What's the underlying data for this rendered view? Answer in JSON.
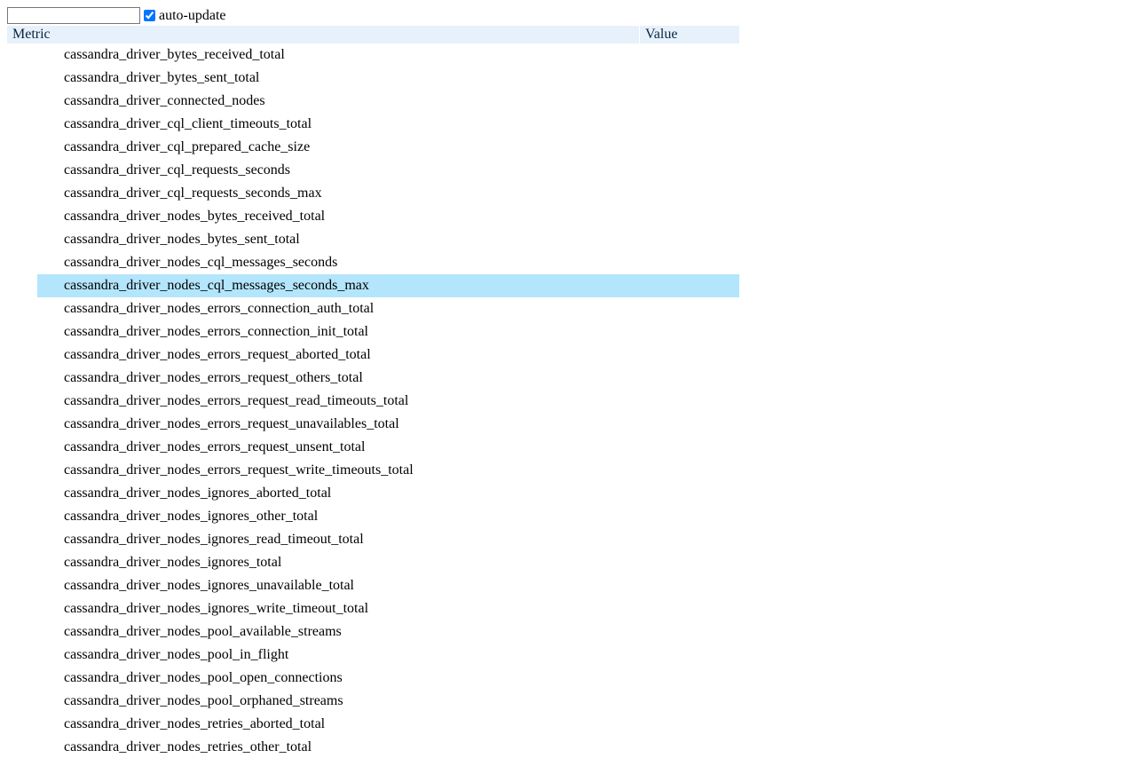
{
  "controls": {
    "filter_value": "",
    "filter_placeholder": "",
    "auto_update_label": "auto-update",
    "auto_update_checked": true
  },
  "table": {
    "header_metric": "Metric",
    "header_value": "Value",
    "rows": [
      {
        "name": "cassandra_driver_bytes_received_total",
        "value": "",
        "selected": false
      },
      {
        "name": "cassandra_driver_bytes_sent_total",
        "value": "",
        "selected": false
      },
      {
        "name": "cassandra_driver_connected_nodes",
        "value": "",
        "selected": false
      },
      {
        "name": "cassandra_driver_cql_client_timeouts_total",
        "value": "",
        "selected": false
      },
      {
        "name": "cassandra_driver_cql_prepared_cache_size",
        "value": "",
        "selected": false
      },
      {
        "name": "cassandra_driver_cql_requests_seconds",
        "value": "",
        "selected": false
      },
      {
        "name": "cassandra_driver_cql_requests_seconds_max",
        "value": "",
        "selected": false
      },
      {
        "name": "cassandra_driver_nodes_bytes_received_total",
        "value": "",
        "selected": false
      },
      {
        "name": "cassandra_driver_nodes_bytes_sent_total",
        "value": "",
        "selected": false
      },
      {
        "name": "cassandra_driver_nodes_cql_messages_seconds",
        "value": "",
        "selected": false
      },
      {
        "name": "cassandra_driver_nodes_cql_messages_seconds_max",
        "value": "",
        "selected": true
      },
      {
        "name": "cassandra_driver_nodes_errors_connection_auth_total",
        "value": "",
        "selected": false
      },
      {
        "name": "cassandra_driver_nodes_errors_connection_init_total",
        "value": "",
        "selected": false
      },
      {
        "name": "cassandra_driver_nodes_errors_request_aborted_total",
        "value": "",
        "selected": false
      },
      {
        "name": "cassandra_driver_nodes_errors_request_others_total",
        "value": "",
        "selected": false
      },
      {
        "name": "cassandra_driver_nodes_errors_request_read_timeouts_total",
        "value": "",
        "selected": false
      },
      {
        "name": "cassandra_driver_nodes_errors_request_unavailables_total",
        "value": "",
        "selected": false
      },
      {
        "name": "cassandra_driver_nodes_errors_request_unsent_total",
        "value": "",
        "selected": false
      },
      {
        "name": "cassandra_driver_nodes_errors_request_write_timeouts_total",
        "value": "",
        "selected": false
      },
      {
        "name": "cassandra_driver_nodes_ignores_aborted_total",
        "value": "",
        "selected": false
      },
      {
        "name": "cassandra_driver_nodes_ignores_other_total",
        "value": "",
        "selected": false
      },
      {
        "name": "cassandra_driver_nodes_ignores_read_timeout_total",
        "value": "",
        "selected": false
      },
      {
        "name": "cassandra_driver_nodes_ignores_total",
        "value": "",
        "selected": false
      },
      {
        "name": "cassandra_driver_nodes_ignores_unavailable_total",
        "value": "",
        "selected": false
      },
      {
        "name": "cassandra_driver_nodes_ignores_write_timeout_total",
        "value": "",
        "selected": false
      },
      {
        "name": "cassandra_driver_nodes_pool_available_streams",
        "value": "",
        "selected": false
      },
      {
        "name": "cassandra_driver_nodes_pool_in_flight",
        "value": "",
        "selected": false
      },
      {
        "name": "cassandra_driver_nodes_pool_open_connections",
        "value": "",
        "selected": false
      },
      {
        "name": "cassandra_driver_nodes_pool_orphaned_streams",
        "value": "",
        "selected": false
      },
      {
        "name": "cassandra_driver_nodes_retries_aborted_total",
        "value": "",
        "selected": false
      },
      {
        "name": "cassandra_driver_nodes_retries_other_total",
        "value": "",
        "selected": false
      }
    ]
  }
}
